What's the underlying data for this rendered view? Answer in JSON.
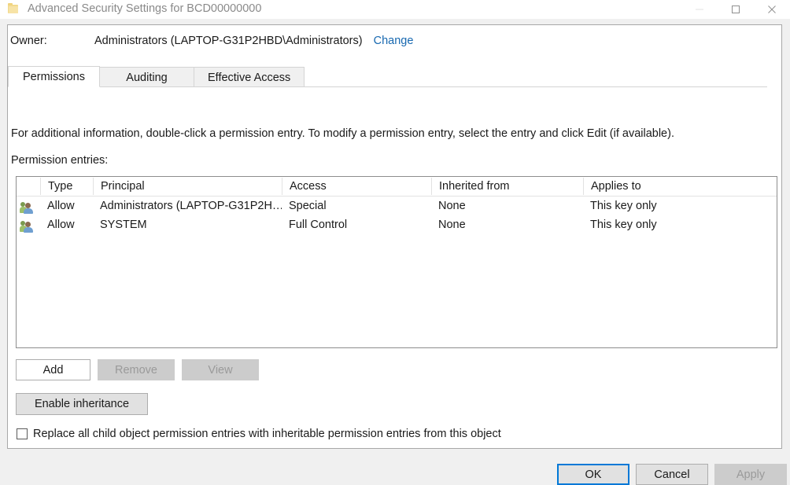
{
  "window": {
    "title": "Advanced Security Settings for BCD00000000",
    "icon": "folder-icon",
    "controls": {
      "minimize": "minimize-icon",
      "maximize": "maximize-icon",
      "close": "close-icon"
    }
  },
  "owner": {
    "label": "Owner:",
    "value": "Administrators (LAPTOP-G31P2HBD\\Administrators)",
    "change_link": "Change"
  },
  "tabs": [
    {
      "label": "Permissions",
      "active": true
    },
    {
      "label": "Auditing",
      "active": false
    },
    {
      "label": "Effective Access",
      "active": false
    }
  ],
  "info_text": "For additional information, double-click a permission entry. To modify a permission entry, select the entry and click Edit (if available).",
  "entries_label": "Permission entries:",
  "table": {
    "columns": [
      "",
      "Type",
      "Principal",
      "Access",
      "Inherited from",
      "Applies to"
    ],
    "rows": [
      {
        "icon": "users-icon",
        "type": "Allow",
        "principal": "Administrators (LAPTOP-G31P2H…",
        "access": "Special",
        "inherited_from": "None",
        "applies_to": "This key only"
      },
      {
        "icon": "users-icon",
        "type": "Allow",
        "principal": "SYSTEM",
        "access": "Full Control",
        "inherited_from": "None",
        "applies_to": "This key only"
      }
    ]
  },
  "buttons": {
    "add": "Add",
    "remove": "Remove",
    "view": "View",
    "enable_inheritance": "Enable inheritance"
  },
  "checkbox": {
    "label": "Replace all child object permission entries with inheritable permission entries from this object",
    "checked": false
  },
  "footer": {
    "ok": "OK",
    "cancel": "Cancel",
    "apply": "Apply"
  },
  "colors": {
    "accent": "#0078d7",
    "link": "#1768b0",
    "dialog_bg": "#f0f0f0",
    "disabled_text": "#9a9a9a"
  }
}
